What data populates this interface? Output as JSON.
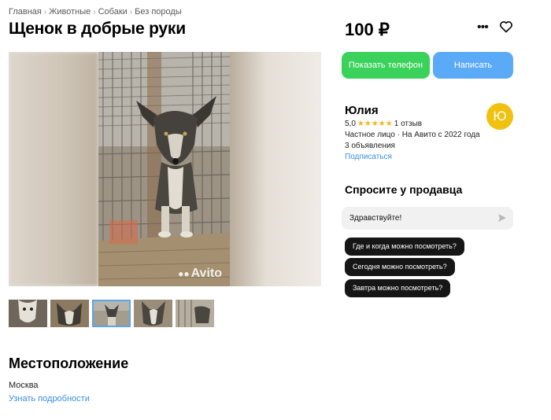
{
  "breadcrumbs": [
    "Главная",
    "Животные",
    "Собаки",
    "Без породы"
  ],
  "breadcrumb_separator": "›",
  "listing": {
    "title": "Щенок в добрые руки",
    "price": "100 ₽",
    "watermark": "Avito"
  },
  "gallery": {
    "thumbnail_count": 5,
    "active_index": 2
  },
  "actions": {
    "more_icon": "more-dots-icon",
    "favorite_icon": "heart-icon",
    "show_phone_label": "Показать телефон",
    "write_label": "Написать"
  },
  "seller": {
    "name": "Юлия",
    "rating": "5,0",
    "stars": "★★★★★",
    "reviews": "1 отзыв",
    "type_line": "Частное лицо · На Авито с 2022 года",
    "ads_count": "3 объявления",
    "subscribe_label": "Подписаться",
    "avatar_letter": "Ю",
    "avatar_color": "#f0c10e"
  },
  "ask": {
    "title": "Спросите у продавца",
    "message_value": "Здравствуйте!",
    "send_icon": "send-icon",
    "quick_questions": [
      "Где и когда можно посмотреть?",
      "Сегодня можно посмотреть?",
      "Завтра можно посмотреть?"
    ]
  },
  "location": {
    "section_title": "Местоположение",
    "city": "Москва",
    "details_link": "Узнать подробности"
  },
  "colors": {
    "phone_button": "#3ad25a",
    "write_button": "#5aaaf8",
    "link": "#3a8ee6",
    "stars": "#f7b51c"
  }
}
